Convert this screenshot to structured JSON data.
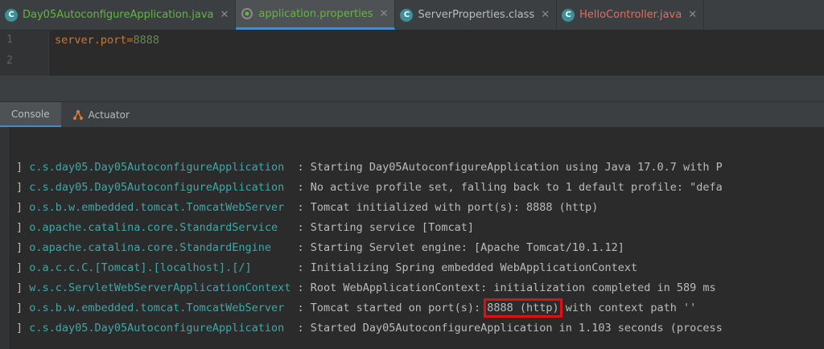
{
  "tabs": [
    {
      "label": "Day05AutoconfigureApplication.java",
      "color": "#62b543",
      "icon": "java-class-icon",
      "active": false
    },
    {
      "label": "application.properties",
      "color": "#62b543",
      "icon": "spring-properties-icon",
      "active": true
    },
    {
      "label": "ServerProperties.class",
      "color": "#bbbbbb",
      "icon": "class-file-icon",
      "active": false
    },
    {
      "label": "HelloController.java",
      "color": "#e06c61",
      "icon": "java-class-icon",
      "active": false
    }
  ],
  "editor": {
    "line_numbers": [
      "1",
      "2"
    ],
    "line1_key": "server.port",
    "line1_eq": "=",
    "line1_value": "8888"
  },
  "toolwindow": {
    "tabs": [
      {
        "label": "Console",
        "active": true
      },
      {
        "label": "Actuator",
        "active": false
      }
    ]
  },
  "console": {
    "rows": [
      {
        "prefix": "] ",
        "logger": "c.s.day05.Day05AutoconfigureApplication ",
        "sep": " : ",
        "message": "Starting Day05AutoconfigureApplication using Java 17.0.7 with P"
      },
      {
        "prefix": "] ",
        "logger": "c.s.day05.Day05AutoconfigureApplication ",
        "sep": " : ",
        "message": "No active profile set, falling back to 1 default profile: \"defa"
      },
      {
        "prefix": "] ",
        "logger": "o.s.b.w.embedded.tomcat.TomcatWebServer ",
        "sep": " : ",
        "message": "Tomcat initialized with port(s): 8888 (http)"
      },
      {
        "prefix": "] ",
        "logger": "o.apache.catalina.core.StandardService  ",
        "sep": " : ",
        "message": "Starting service [Tomcat]"
      },
      {
        "prefix": "] ",
        "logger": "o.apache.catalina.core.StandardEngine   ",
        "sep": " : ",
        "message": "Starting Servlet engine: [Apache Tomcat/10.1.12]"
      },
      {
        "prefix": "] ",
        "logger": "o.a.c.c.C.[Tomcat].[localhost].[/]      ",
        "sep": " : ",
        "message": "Initializing Spring embedded WebApplicationContext"
      },
      {
        "prefix": "] ",
        "logger": "w.s.c.ServletWebServerApplicationContext",
        "sep": " : ",
        "message": "Root WebApplicationContext: initialization completed in 589 ms"
      },
      {
        "prefix": "] ",
        "logger": "o.s.b.w.embedded.tomcat.TomcatWebServer ",
        "sep": " : ",
        "message_pre": "Tomcat started on port(s): ",
        "message_hl": "8888 (http)",
        "message_post": " with context path ''"
      },
      {
        "prefix": "] ",
        "logger": "c.s.day05.Day05AutoconfigureApplication ",
        "sep": " : ",
        "message": "Started Day05AutoconfigureApplication in 1.103 seconds (process"
      }
    ],
    "highlight_color": "#e01010"
  }
}
